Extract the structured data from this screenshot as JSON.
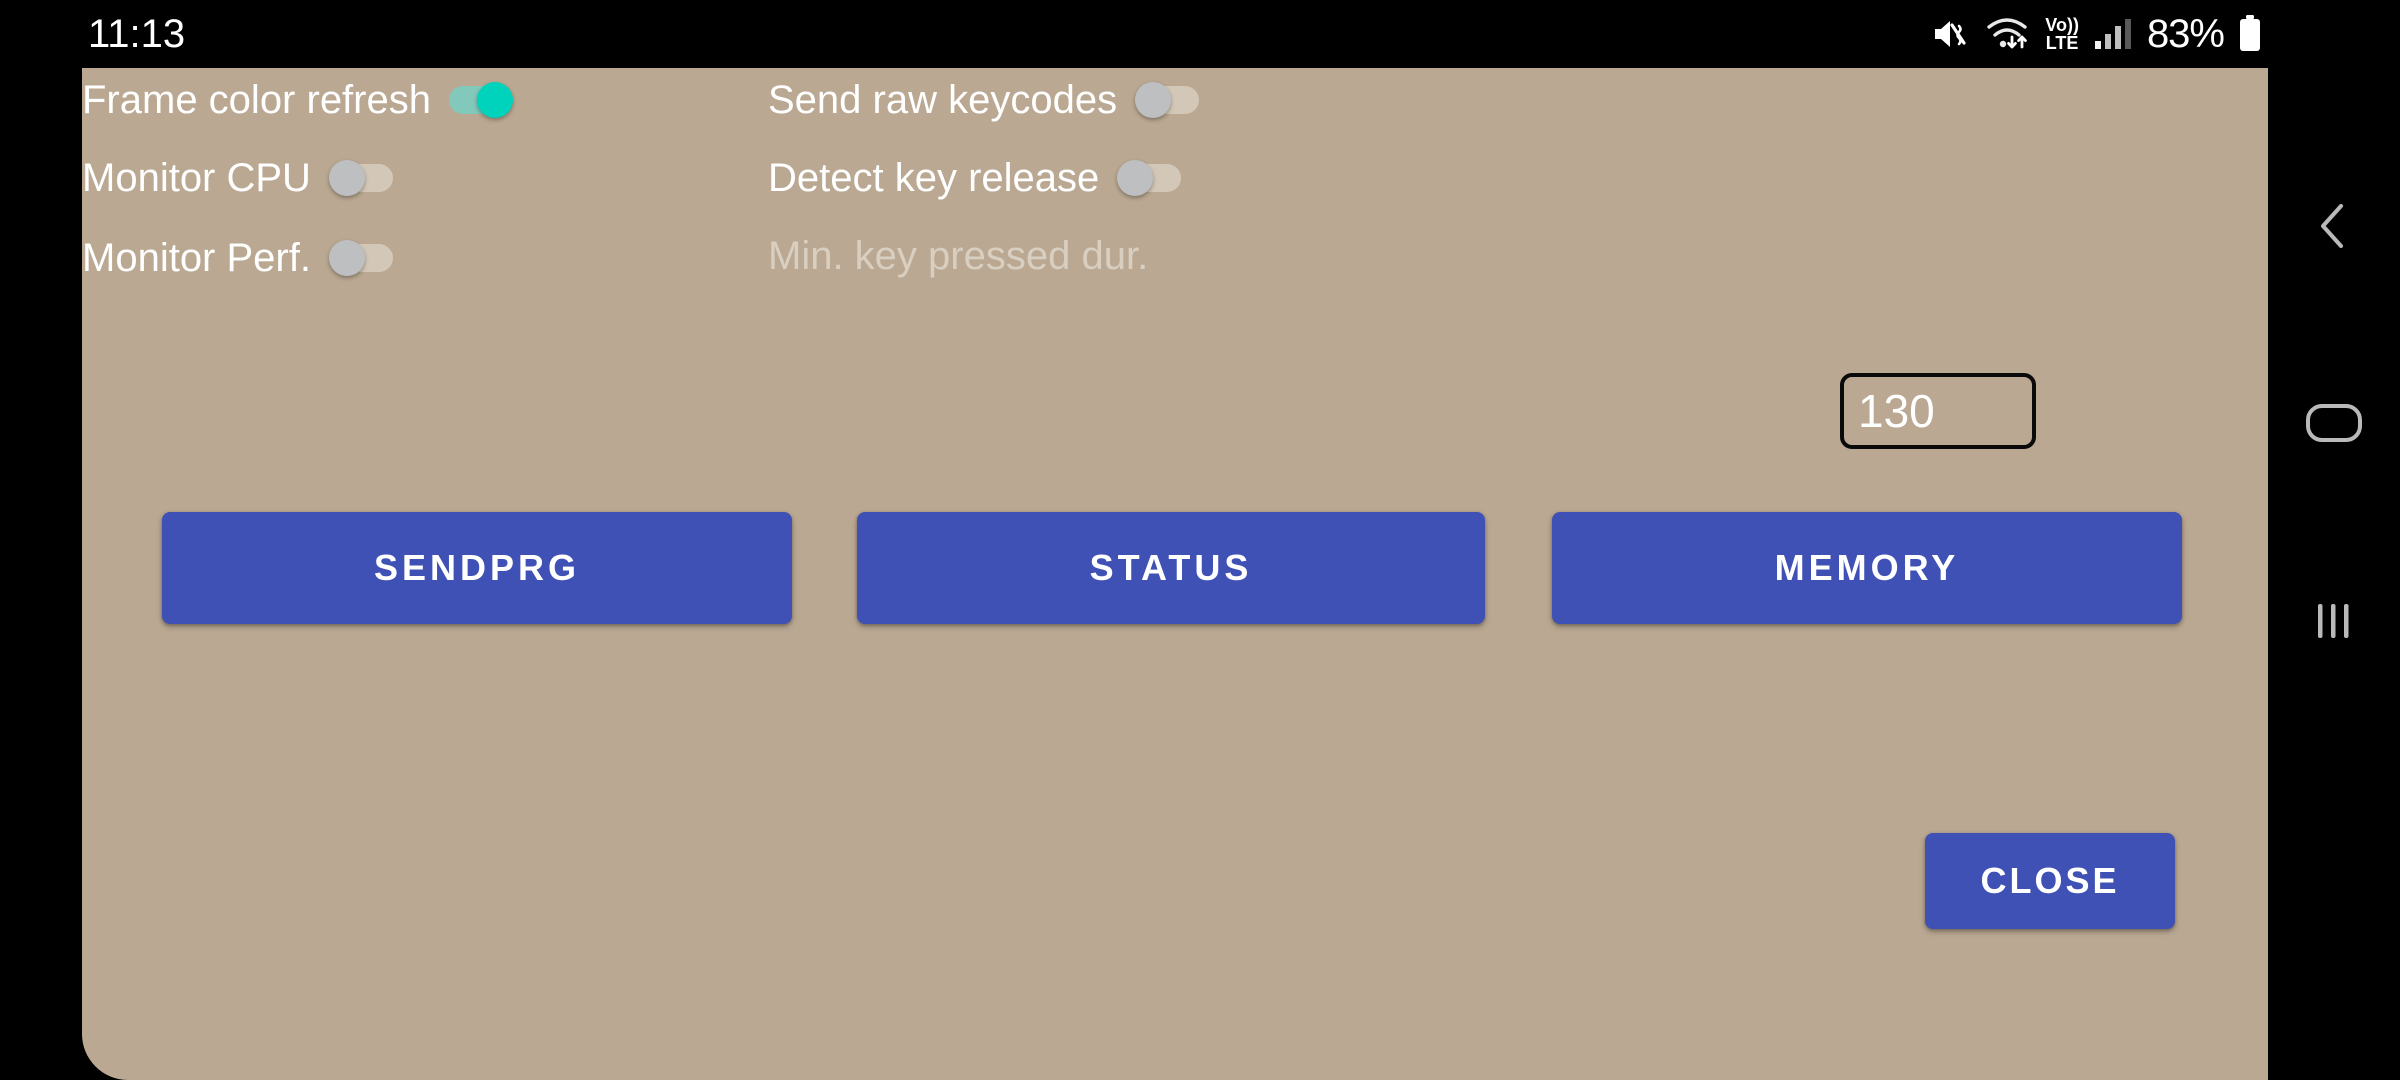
{
  "status_bar": {
    "clock": "11:13",
    "battery_percent": "83%",
    "icons": [
      {
        "name": "mute-vibrate-icon",
        "label": "sound off"
      },
      {
        "name": "wifi-icon",
        "label": "wifi"
      },
      {
        "name": "volte-icon",
        "label_top": "Vo))",
        "label_bottom": "LTE"
      },
      {
        "name": "cellular-signal-icon",
        "label": "signal"
      },
      {
        "name": "battery-icon",
        "label": "battery"
      }
    ]
  },
  "dialog": {
    "background_color": "#BAA892",
    "accent_color": "#3F51B5",
    "toggle_on_color": "#00D3BC",
    "toggle_off_color": "#BDBFC1",
    "settings": [
      {
        "id": "frame-color-refresh",
        "label": "Frame color refresh",
        "state": "on",
        "column": "left",
        "row": 1
      },
      {
        "id": "monitor-cpu",
        "label": "Monitor CPU",
        "state": "off",
        "column": "left",
        "row": 2
      },
      {
        "id": "monitor-perf",
        "label": "Monitor Perf.",
        "state": "off",
        "column": "left",
        "row": 3
      },
      {
        "id": "send-raw-keycodes",
        "label": "Send raw keycodes",
        "state": "off",
        "column": "right",
        "row": 1
      },
      {
        "id": "detect-key-release",
        "label": "Detect key release",
        "state": "off",
        "column": "right",
        "row": 2
      }
    ],
    "min_key_dur": {
      "label": "Min. key pressed dur.",
      "value": "130",
      "disabled": true
    },
    "buttons": {
      "sendprg": "SENDPRG",
      "status": "STATUS",
      "memory": "MEMORY",
      "close": "CLOSE"
    }
  },
  "nav_bar": {
    "back": "back-icon",
    "home": "home-icon",
    "recents": "recents-icon"
  }
}
